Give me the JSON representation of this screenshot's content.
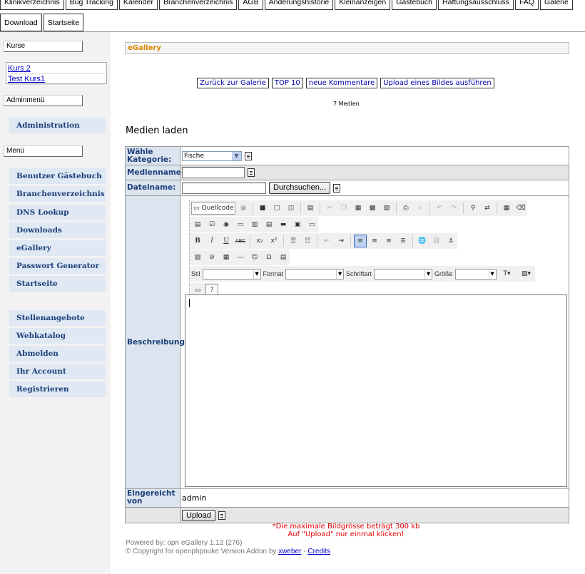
{
  "nav": {
    "row1": [
      "Klinikverzeichnis",
      "Bug Tracking",
      "Kalender",
      "Branchenverzeichnis",
      "AGB",
      "Änderungshistorie",
      "Kleinanzeigen",
      "Gästebuch",
      "Haftungsausschluss",
      "FAQ",
      "Galerie"
    ],
    "row2": [
      "Download",
      "Startseite"
    ]
  },
  "sidebar": {
    "kurse_btn": "Kurse",
    "kurse": [
      "Kurs 2",
      "Test Kurs1"
    ],
    "admin_btn": "Adminmenü",
    "admin_items": [
      "Administration"
    ],
    "menu_btn": "Menü",
    "menu_items": [
      "Benutzer Gästebuch",
      "Branchenverzeichnis",
      "DNS Lookup",
      "Downloads",
      "eGallery",
      "Passwort Generator",
      "Startseite"
    ],
    "user_items": [
      "Stellenangebote",
      "Webkatalog",
      "Abmelden",
      "Ihr Account",
      "Registrieren"
    ]
  },
  "main": {
    "section_title": "eGallery",
    "links": [
      "Zurück zur Galerie",
      "TOP 10",
      "neue Kommentare",
      "Upload eines Bildes ausführen"
    ],
    "media_count": "7 Medien",
    "page_title": "Medien laden"
  },
  "form": {
    "category_label": "Wähle Kategorie:",
    "category_value": "Fische",
    "medianame_label": "Medienname:",
    "medianame_value": "",
    "filename_label": "Dateiname:",
    "browse_button": "Durchsuchen...",
    "description_label": "Beschreibung",
    "submitted_label": "Eingereicht von",
    "submitted_value": "admin",
    "upload_button": "Upload"
  },
  "editor": {
    "source_button": "Quellcode",
    "style_label": "Stil",
    "format_label": "Format",
    "font_label": "Schriftart",
    "size_label": "Größe"
  },
  "notes": {
    "line1": "*Die maximale Bildgrösse beträgt 300 kb",
    "line2": "Auf \"Upload\" nur einmal klicken!"
  },
  "footer": {
    "powered": "Powered by: opn eGallery 1.12 (276)",
    "copyright_prefix": "© Copyright for openphpnuke Version Addon by",
    "author_link": "xweber",
    "dash": "-",
    "credits_link": "Credits"
  },
  "colors": {
    "menu_text": "#1c3f7a",
    "menu_bg": "#dfe8f3",
    "section_title": "#d98a00",
    "warning": "#e00000",
    "link": "#0000cc"
  }
}
